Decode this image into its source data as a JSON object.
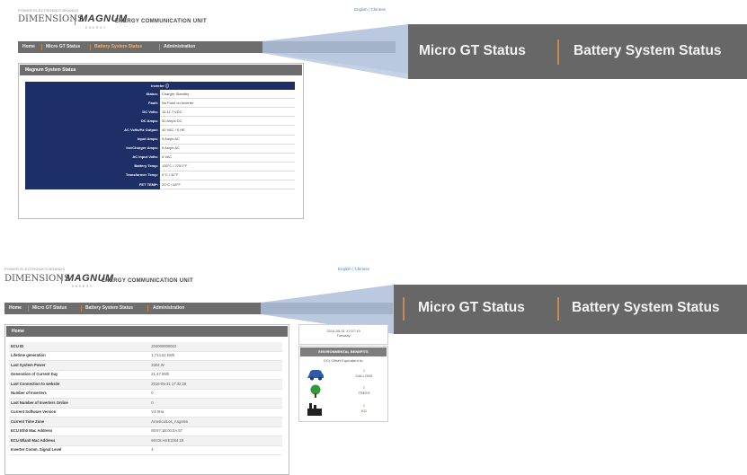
{
  "top_window": {
    "brand_small": "POWER ELECTRONICS BRANDS",
    "brand_dimensions": "DIMENSIONS",
    "brand_magnum": "MAGNUM",
    "brand_magnum_sub": "ENERGY",
    "brand_ecu": "ENERGY COMMUNICATION UNIT",
    "lang_english": "English",
    "lang_sep": "|",
    "lang_chinese": "Chinese",
    "nav": [
      "Home",
      "Micro GT Status",
      "Battery System Status",
      "Administration"
    ],
    "zoom_labels": [
      "Micro GT Status",
      "Battery System Status"
    ],
    "panel_title": "Magnum System Status",
    "inverter_header": "Inverter ⓘ",
    "rows": [
      {
        "label": "Status:",
        "value": "Charger Standby"
      },
      {
        "label": "Fault:",
        "value": "No Fault on Inverter"
      },
      {
        "label": "DC Volts:",
        "value": "15.11.7 VDC"
      },
      {
        "label": "DC Amps:",
        "value": "30 Amps DC"
      },
      {
        "label": "AC Volts/Hz Output:",
        "value": "40 VAC / 0 HE"
      },
      {
        "label": "Input Amps:",
        "value": "5 Amps AC"
      },
      {
        "label": "Inv/Charger Amps:",
        "value": "5 Amps AC"
      },
      {
        "label": "AC Input Volts:",
        "value": "5 VAC"
      },
      {
        "label": "Battery Temp:",
        "value": "135°C / 275.0°F"
      },
      {
        "label": "Transformer Temp:",
        "value": "0°C / 32°F"
      },
      {
        "label": "FET TEMP:",
        "value": "20°C / 68°F"
      }
    ]
  },
  "bottom_window": {
    "brand_small": "POWER ELECTRONICS BRANDS",
    "brand_dimensions": "DIMENSIONS",
    "brand_magnum": "MAGNUM",
    "brand_magnum_sub": "ENERGY",
    "brand_ecu": "ENERGY COMMUNICATION UNIT",
    "lang_english": "English",
    "lang_sep": "|",
    "lang_chinese": "Chinese",
    "nav": [
      "Home",
      "Micro GT Status",
      "Battery System Status",
      "Administration"
    ],
    "zoom_labels": [
      "Micro GT Status",
      "Battery System Status"
    ],
    "panel_title": "Home",
    "rows": [
      {
        "label": "ECU ID",
        "value": "204000000022"
      },
      {
        "label": "Lifetime generation",
        "value": "1,714.51 kWh"
      },
      {
        "label": "Last System Power",
        "value": "3304 W"
      },
      {
        "label": "Generation of Current Day",
        "value": "21.47 kWh"
      },
      {
        "label": "Last Connection to website",
        "value": "2016-05-31 17:32:28"
      },
      {
        "label": "Number of Inverters",
        "value": "0"
      },
      {
        "label": "Last Number of Inverters Online",
        "value": "0"
      },
      {
        "label": "Current Software Version",
        "value": "V4.0Ha"
      },
      {
        "label": "Current Time Zone",
        "value": "America/Los_Angeles"
      },
      {
        "label": "ECU Eth0 Mac Address",
        "value": "80:97:1B:00:0A:57"
      },
      {
        "label": "ECU Wlan0 Mac Address",
        "value": "60:C5:A8:E3:B4:19"
      },
      {
        "label": "Inverter Comm. Signal Level",
        "value": "4"
      }
    ],
    "datetime": "2016-05-31 17:07:19",
    "weekday": "Tuesday",
    "env_title": "ENVIRONMENTAL BENEFITS",
    "co2_text": "CO₂ Offset Equivalent to:",
    "gallons_value": "0",
    "gallons_label": "GALLONS",
    "trees_value": "0",
    "trees_label": "TREES",
    "kg_value": "0",
    "kg_label": "KG"
  }
}
